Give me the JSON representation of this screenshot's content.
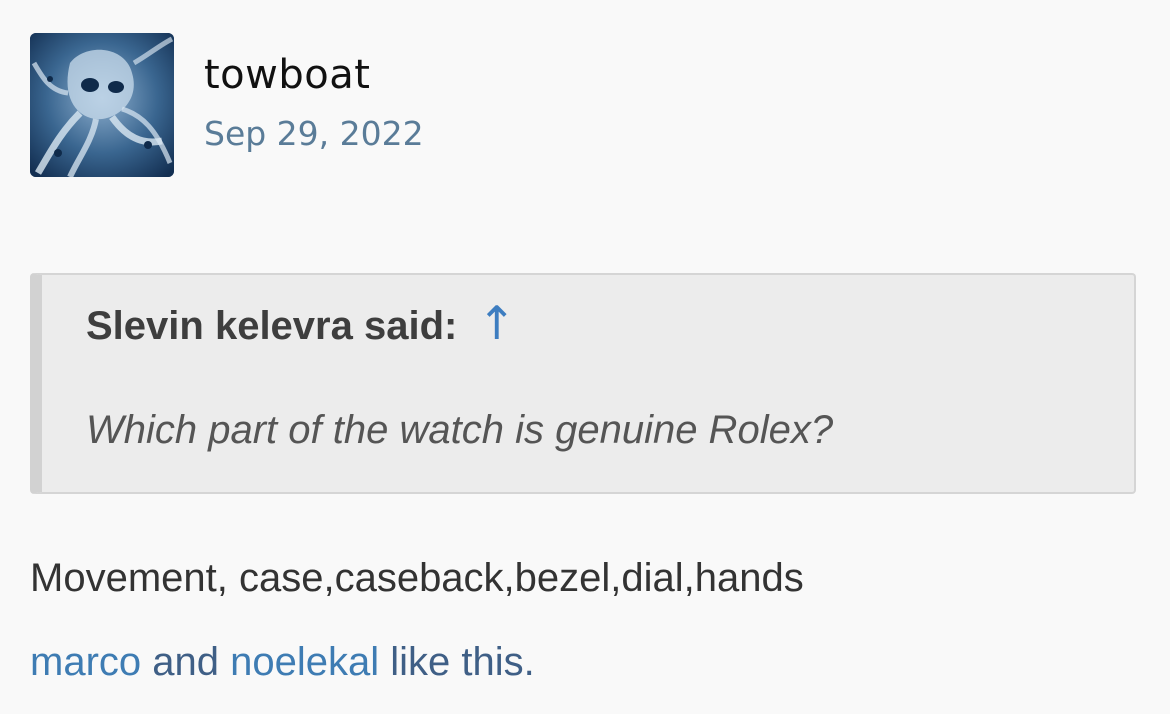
{
  "post": {
    "author": "towboat",
    "date": "Sep 29, 2022",
    "avatar_icon": "kraken-avatar-icon",
    "quote": {
      "attribution": "Slevin kelevra said:",
      "jump_icon": "↑",
      "text": "Which part of the watch is genuine Rolex?"
    },
    "body": "Movement, case,caseback,bezel,dial,hands",
    "likes": {
      "user1": "marco",
      "conjunction": " and ",
      "user2": "noelekal",
      "suffix": " like this."
    }
  },
  "colors": {
    "background": "#f9f9f9",
    "link": "#3e7cb3",
    "date": "#5a7c98",
    "quote_bg": "#ececec"
  }
}
